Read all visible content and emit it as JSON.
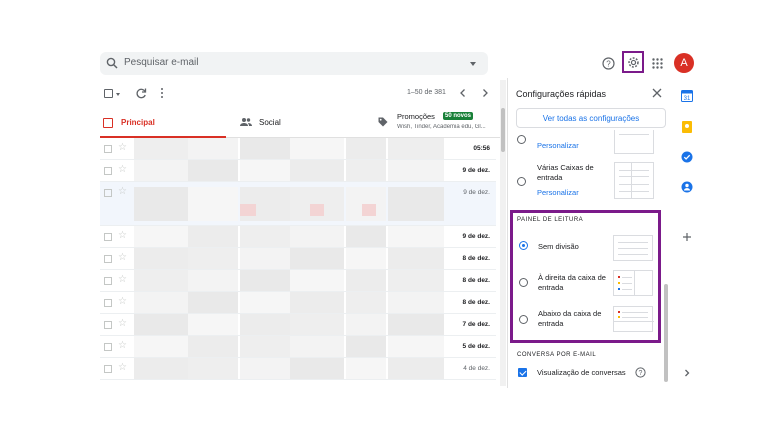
{
  "search": {
    "placeholder": "Pesquisar e-mail"
  },
  "header": {
    "avatar_letter": "A"
  },
  "toolbar": {
    "pager": "1–50 de 381"
  },
  "tabs": [
    {
      "label": "Principal"
    },
    {
      "label": "Social"
    },
    {
      "label": "Promoções",
      "badge": "50 novos",
      "sub": "Wish, Tinder, Academia edu, Gl..."
    }
  ],
  "mail_rows": [
    {
      "date": "05:56",
      "style": "bold"
    },
    {
      "date": "9 de dez.",
      "style": "bold"
    },
    {
      "date": "9 de dez.",
      "style": "read"
    },
    {
      "date": "9 de dez.",
      "style": "bold"
    },
    {
      "date": "8 de dez.",
      "style": "bold"
    },
    {
      "date": "8 de dez.",
      "style": "bold"
    },
    {
      "date": "8 de dez.",
      "style": "bold"
    },
    {
      "date": "7 de dez.",
      "style": "bold"
    },
    {
      "date": "5 de dez.",
      "style": "bold"
    },
    {
      "date": "4 de dez.",
      "style": "read"
    }
  ],
  "quick_settings": {
    "title": "Configurações rápidas",
    "see_all": "Ver todas as configurações",
    "customize_top": "Personalizar",
    "multiple_inboxes": "Várias Caixas de entrada",
    "customize_bottom": "Personalizar",
    "reading_pane_header": "PAINEL DE LEITURA",
    "reading_pane_options": [
      {
        "label": "Sem divisão",
        "selected": true
      },
      {
        "label": "À direita da caixa de entrada",
        "selected": false
      },
      {
        "label": "Abaixo da caixa de entrada",
        "selected": false
      }
    ],
    "conversation_header": "CONVERSA POR E-MAIL",
    "conversation_view": "Visualização de conversas"
  },
  "colors": {
    "accent": "#1a73e8",
    "primary_tab": "#d93025",
    "highlight": "#7b1a8a",
    "promo_badge": "#188038"
  }
}
